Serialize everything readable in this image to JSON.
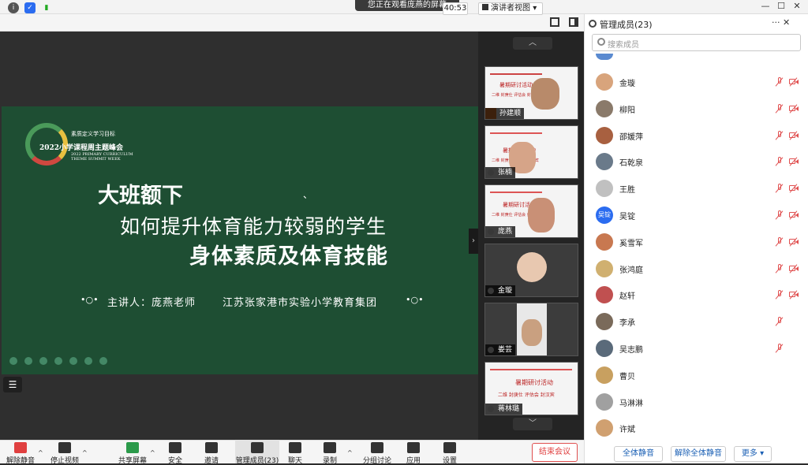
{
  "window": {
    "banner": "您正在观看庞燕的屏幕",
    "controls": [
      "—",
      "☐",
      "✕"
    ]
  },
  "toolbar": {
    "timer": "40:53",
    "view_label": "演讲者视图",
    "view_caret": "▾"
  },
  "slide": {
    "logo_line1": "素质定义学习目标",
    "logo_line2": "2022小学课程周主题峰会",
    "logo_line3": "2022 PRIMARY CURRICULUM",
    "logo_line4": "THEME SUMMIT WEEK",
    "title1": "大班额下",
    "title2": "如何提升体育能力较弱的学生",
    "title3": "身体素质及体育技能",
    "presenter": "主讲人：庞燕老师",
    "organization": "江苏张家港市实验小学教育集团",
    "bullets_left": "•○•",
    "bullets_right": "•○•",
    "dot": "、"
  },
  "main": {
    "menu_icon": "☰",
    "collapse_icon": "›"
  },
  "thumbnails": {
    "scroll_up": "︿",
    "scroll_down": "﹀",
    "items": [
      {
        "name": "孙建顺",
        "slide_title": "暑期研讨活动",
        "slide_sub": "二维  封庚仕  评估会  封汉宾"
      },
      {
        "name": "张楠",
        "slide_title": "暑期研讨活动",
        "slide_sub": "二维  封庚仕  评估会  封汉宾"
      },
      {
        "name": "庞燕",
        "slide_title": "暑期研讨活动",
        "slide_sub": "二维  封庚仕  评估会  封汉宾"
      },
      {
        "name": "金璇",
        "slide_title": "",
        "slide_sub": ""
      },
      {
        "name": "娄芸",
        "slide_title": "",
        "slide_sub": ""
      },
      {
        "name": "蒋林璐",
        "slide_title": "暑期研讨活动",
        "slide_sub": "二维  封庚仕  评估会  封汉宾"
      }
    ]
  },
  "panel": {
    "title": "管理成员(23)",
    "tools": "···  ✕",
    "search_placeholder": "搜索成员",
    "members": [
      {
        "name": "金璇",
        "avatar": "",
        "color": "#d8a47c",
        "muted": true,
        "cam_off": true
      },
      {
        "name": "柳阳",
        "avatar": "",
        "color": "#8a7a6a",
        "muted": true,
        "cam_off": true
      },
      {
        "name": "邵媛萍",
        "avatar": "",
        "color": "#a86040",
        "muted": true,
        "cam_off": true
      },
      {
        "name": "石乾泉",
        "avatar": "",
        "color": "#6a7a8a",
        "muted": true,
        "cam_off": true
      },
      {
        "name": "王胜",
        "avatar": "",
        "color": "#c0c0c0",
        "muted": true,
        "cam_off": true
      },
      {
        "name": "吴锭",
        "avatar": "吴锭",
        "color": "#2b6cf0",
        "muted": true,
        "cam_off": true
      },
      {
        "name": "奚雪军",
        "avatar": "",
        "color": "#c87850",
        "muted": true,
        "cam_off": true
      },
      {
        "name": "张鸿庭",
        "avatar": "",
        "color": "#d0b070",
        "muted": true,
        "cam_off": true
      },
      {
        "name": "赵轩",
        "avatar": "",
        "color": "#c05050",
        "muted": true,
        "cam_off": true
      },
      {
        "name": "李承",
        "avatar": "",
        "color": "#7a6a5a",
        "muted": true,
        "cam_off": false
      },
      {
        "name": "吴志鹏",
        "avatar": "",
        "color": "#5a6a7a",
        "muted": true,
        "cam_off": false
      },
      {
        "name": "曹贝",
        "avatar": "",
        "color": "#c8a060",
        "muted": false,
        "cam_off": false
      },
      {
        "name": "马淋淋",
        "avatar": "",
        "color": "#a0a0a0",
        "muted": false,
        "cam_off": false
      },
      {
        "name": "许斌",
        "avatar": "",
        "color": "#d0a070",
        "muted": false,
        "cam_off": false
      }
    ],
    "btn_mute_all": "全体静音",
    "btn_unmute_all": "解除全体静音",
    "btn_more": "更多 ▾"
  },
  "bottombar": {
    "items": [
      {
        "label": "解除静音",
        "icon": "mic-muted-icon"
      },
      {
        "label": "停止视频",
        "icon": "video-icon"
      },
      {
        "label": "共享屏幕",
        "icon": "share-screen-icon"
      },
      {
        "label": "安全",
        "icon": "shield-icon"
      },
      {
        "label": "邀请",
        "icon": "invite-icon"
      },
      {
        "label": "管理成员(23)",
        "icon": "participants-icon"
      },
      {
        "label": "聊天",
        "icon": "chat-icon"
      },
      {
        "label": "录制",
        "icon": "record-icon"
      },
      {
        "label": "分组讨论",
        "icon": "breakout-icon"
      },
      {
        "label": "应用",
        "icon": "apps-icon"
      },
      {
        "label": "设置",
        "icon": "gear-icon"
      }
    ],
    "caret": "^",
    "end_meeting": "结束会议"
  }
}
